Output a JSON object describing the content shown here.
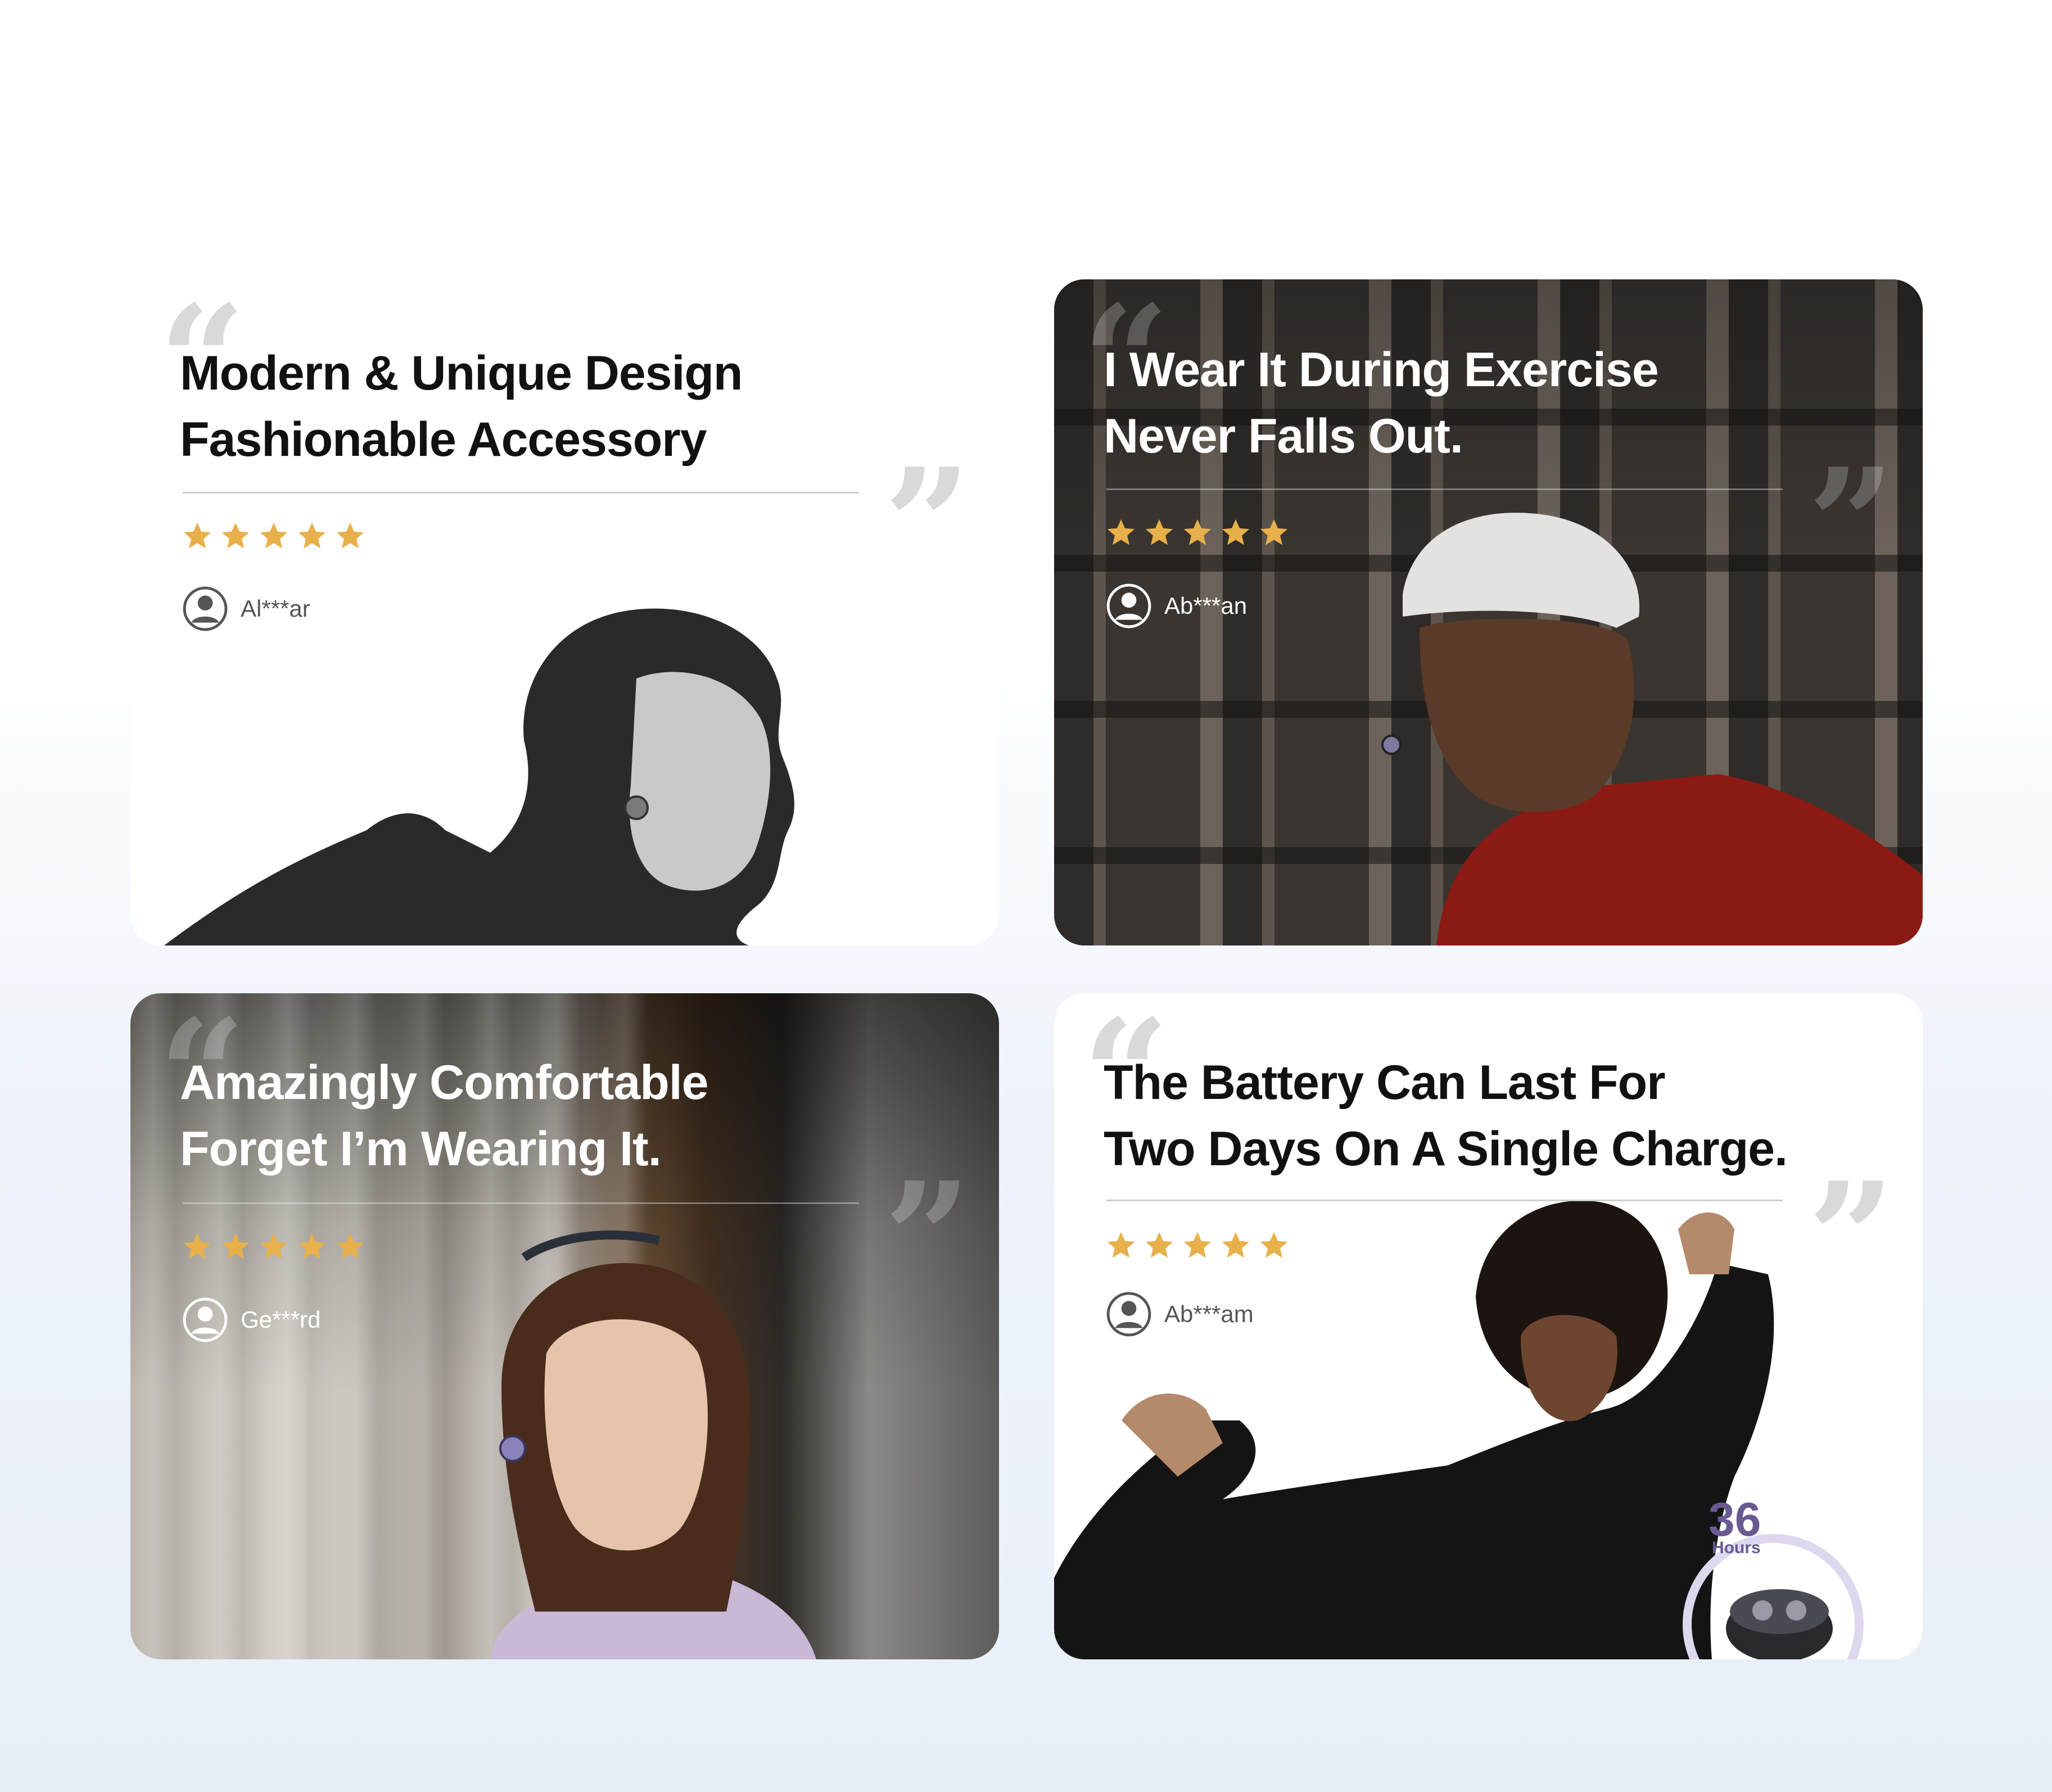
{
  "reviews": [
    {
      "headline_line1": "Modern & Unique Design",
      "headline_line2": "Fashionable Accessory",
      "rating": 5,
      "user": "Al***ar",
      "theme": "light"
    },
    {
      "headline_line1": "I Wear It During Exercise",
      "headline_line2": "Never Falls Out.",
      "rating": 5,
      "user": "Ab***an",
      "theme": "dark"
    },
    {
      "headline_line1": "Amazingly Comfortable",
      "headline_line2": "Forget I’m Wearing It.",
      "rating": 5,
      "user": "Ge***rd",
      "theme": "dark"
    },
    {
      "headline_line1": "The Battery Can Last For",
      "headline_line2": "Two Days On A Single Charge.",
      "rating": 5,
      "user": "Ab***am",
      "theme": "light"
    }
  ],
  "battery_badge": {
    "value": "36",
    "unit": "Hours"
  },
  "colors": {
    "star": "#e8b04a",
    "badge": "#6a5a92"
  }
}
